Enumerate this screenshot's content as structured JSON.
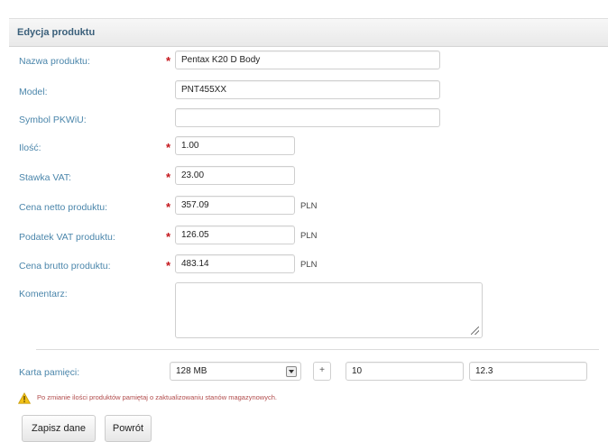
{
  "panel": {
    "title": "Edycja produktu"
  },
  "fields": {
    "name": {
      "label": "Nazwa produktu:",
      "value": "Pentax K20 D Body",
      "required_mark": "*"
    },
    "model": {
      "label": "Model:",
      "value": "PNT455XX"
    },
    "pkwiu": {
      "label": "Symbol PKWiU:",
      "value": ""
    },
    "quantity": {
      "label": "Ilość:",
      "value": "1.00",
      "required_mark": "*"
    },
    "vat_rate": {
      "label": "Stawka VAT:",
      "value": "23.00",
      "required_mark": "*"
    },
    "net_price": {
      "label": "Cena netto produktu:",
      "value": "357.09",
      "unit": "PLN",
      "required_mark": "*"
    },
    "vat_amount": {
      "label": "Podatek VAT produktu:",
      "value": "126.05",
      "unit": "PLN",
      "required_mark": "*"
    },
    "gross_price": {
      "label": "Cena brutto produktu:",
      "value": "483.14",
      "unit": "PLN",
      "required_mark": "*"
    },
    "comment": {
      "label": "Komentarz:",
      "value": ""
    }
  },
  "memory_card": {
    "label": "Karta pamięci:",
    "select_value": "128 MB",
    "operator": "+",
    "amount": "10",
    "result": "12.3"
  },
  "warning": {
    "icon": "warning-icon",
    "text": "Po zmianie ilości produktów pamiętaj o zaktualizowaniu stanów magazynowych."
  },
  "buttons": {
    "save": "Zapisz dane",
    "back": "Powrót"
  },
  "colors": {
    "label": "#4b86ab",
    "required": "#c4161c",
    "title": "#3a5f7a",
    "warning_text": "#b14b4b",
    "warning_icon": "#f2c218"
  }
}
